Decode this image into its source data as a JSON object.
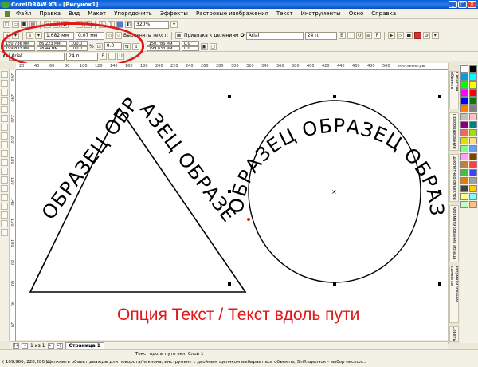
{
  "window": {
    "title": "CorelDRAW X3 - [Рисунок1]"
  },
  "menu": [
    "Файл",
    "Правка",
    "Вид",
    "Макет",
    "Упорядочить",
    "Эффекты",
    "Растровые изображения",
    "Текст",
    "Инструменты",
    "Окно",
    "Справка"
  ],
  "toolbar1": {
    "zoom": "320%"
  },
  "toolbar2": {
    "distance": "1,682 мм",
    "offset": "0,07 мм",
    "fit_text_label": "Выровнять текст:",
    "snap_label": "Привязка к делениям",
    "font": "Arial",
    "size": "24 п."
  },
  "toolbar3": {
    "x": "150.786 мм",
    "y": "199.833 мм",
    "w": "86.223 мм",
    "h": "78.44 мм",
    "scale_w": "100.0",
    "scale_h": "100.0",
    "percent": "%",
    "angle": "0.0",
    "x2": "150.786 мм",
    "y2": "199.833 мм",
    "ang2": "0.0",
    "ang3": "0.0"
  },
  "toolbar4": {
    "font": "Arial",
    "size": "24 п."
  },
  "ruler": {
    "h_ticks": [
      "20",
      "40",
      "60",
      "80",
      "100",
      "120",
      "140",
      "160",
      "180",
      "200",
      "220",
      "240",
      "260",
      "280",
      "300",
      "320",
      "340",
      "360",
      "380",
      "400",
      "420",
      "440",
      "460",
      "480",
      "500"
    ],
    "h_unit": "миллиметры",
    "v_ticks": [
      "260",
      "240",
      "220",
      "200",
      "180",
      "160",
      "140",
      "120",
      "100",
      "80",
      "60",
      "40",
      "20"
    ]
  },
  "canvas": {
    "path_text_triangle": "ОБРАЗЕЦ ОБРАЗЕЦ ОБРАЗЕЦ",
    "path_text_circle": "ОБРАЗЕЦ ОБРАЗЕЦ ОБРАЗЕЦ",
    "caption": "Опция Текст / Текст вдоль пути",
    "caption_color": "#e01818"
  },
  "docker_tabs": [
    "Свойства объекта",
    "Преобразование",
    "Диспетчер объектов",
    "Форматирование абзаца",
    "Форматирование символов",
    "Советы"
  ],
  "pagenav": {
    "count": "1 из 1",
    "page": "Страница 1"
  },
  "status": {
    "center": "Текст вдоль пути вкл. Слой 1",
    "coords": "( 109,966; 228,280 )",
    "hint": "Щелкните объект дважды для поворота/наклона; инструмент с двойным щелчком выбирает все объекты; Shift-щелчок - выбор нескол..."
  },
  "palette_colors": [
    "#ffffff",
    "#000000",
    "#00a0e0",
    "#00ffff",
    "#00ff00",
    "#ffff00",
    "#ff00ff",
    "#ff0000",
    "#0000ff",
    "#008000",
    "#ff8000",
    "#808080",
    "#c0c0c0",
    "#ffc0cb",
    "#800080",
    "#008080",
    "#ff6060",
    "#a0e000",
    "#e0e000",
    "#ffe080",
    "#80ff80",
    "#60a0ff",
    "#ffa0ff",
    "#804000",
    "#c08040",
    "#ff4040",
    "#40c040",
    "#4040ff",
    "#e08000",
    "#a0a0a0",
    "#404040",
    "#ffd000",
    "#ffff80",
    "#80ffff",
    "#c0ffc0",
    "#ffc080"
  ]
}
